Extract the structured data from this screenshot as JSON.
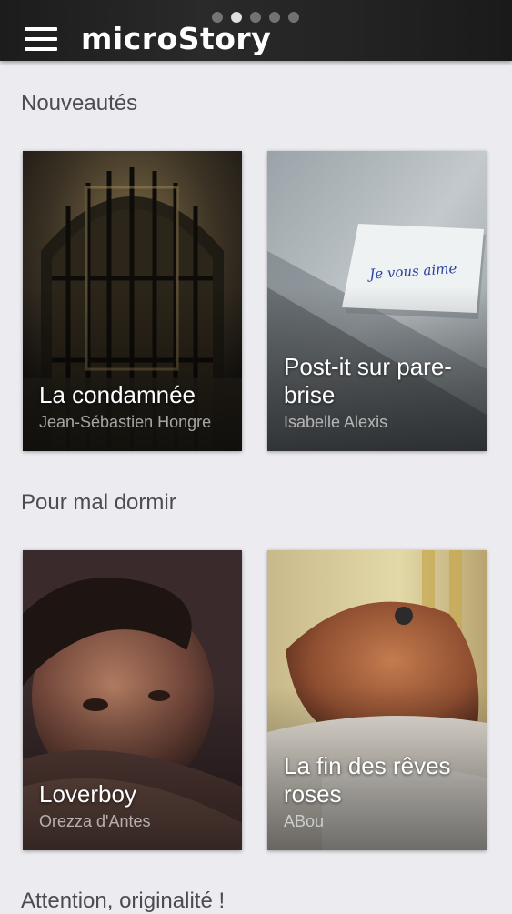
{
  "header": {
    "app_title": "microStory",
    "page_count": 5,
    "active_page": 2
  },
  "sections": [
    {
      "title": "Nouveautés",
      "stories": [
        {
          "title": "La condamnée",
          "author": "Jean-Sébastien Hongre"
        },
        {
          "title": "Post-it sur pare-brise",
          "author": "Isabelle Alexis",
          "note_text": "Je vous aime"
        }
      ]
    },
    {
      "title": "Pour mal dormir",
      "stories": [
        {
          "title": "Loverboy",
          "author": "Orezza d'Antes"
        },
        {
          "title": "La fin des rêves roses",
          "author": "ABou"
        }
      ]
    },
    {
      "title": "Attention, originalité !"
    }
  ]
}
